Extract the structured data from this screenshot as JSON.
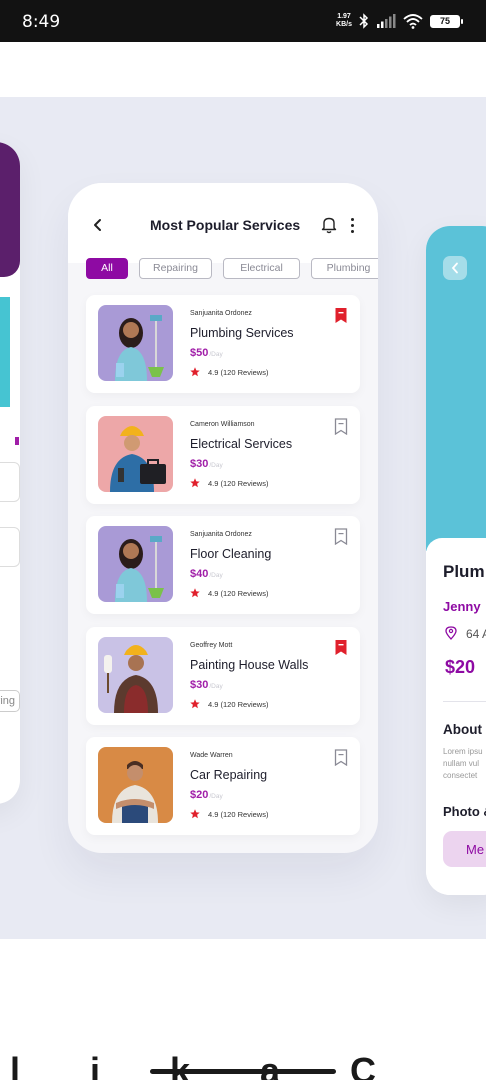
{
  "status_bar": {
    "time": "8:49",
    "speed_value": "1.97",
    "speed_unit": "KB/s",
    "battery": "75"
  },
  "main": {
    "title": "Most Popular Services",
    "filters": [
      "All",
      "Repairing",
      "Electrical",
      "Plumbing"
    ],
    "active_filter": "All",
    "services": [
      {
        "provider": "Sanjuanita Ordonez",
        "name": "Plumbing Services",
        "price": "$50",
        "unit": "/Day",
        "rating": "4.9 (120 Reviews)",
        "bookmarked": true,
        "thumb_bg": "#a99ad6"
      },
      {
        "provider": "Cameron Williamson",
        "name": "Electrical Services",
        "price": "$30",
        "unit": "/Day",
        "rating": "4.9 (120 Reviews)",
        "bookmarked": false,
        "thumb_bg": "#eda7a8"
      },
      {
        "provider": "Sanjuanita Ordonez",
        "name": "Floor Cleaning",
        "price": "$40",
        "unit": "/Day",
        "rating": "4.9 (120 Reviews)",
        "bookmarked": false,
        "thumb_bg": "#a99ad6"
      },
      {
        "provider": "Geoffrey Mott",
        "name": "Painting House Walls",
        "price": "$30",
        "unit": "/Day",
        "rating": "4.9 (120 Reviews)",
        "bookmarked": true,
        "thumb_bg": "#c9c2e6"
      },
      {
        "provider": "Wade Warren",
        "name": "Car Repairing",
        "price": "$20",
        "unit": "/Day",
        "rating": "4.9 (120 Reviews)",
        "bookmarked": false,
        "thumb_bg": "#d88a45"
      }
    ]
  },
  "right_card": {
    "title": "Plum",
    "owner": "Jenny",
    "address": "64 A",
    "price": "$20",
    "about": "About",
    "description": "Lorem ipsu\nnullam vul\nconsectet",
    "photo_label": "Photo &",
    "message_button": "Me"
  },
  "left_card": {
    "tag": "ring"
  },
  "bottom_text": "l i k a   C",
  "colors": {
    "accent": "#8e0aa3",
    "price": "#a01ea8",
    "bookmark_active": "#e0202c",
    "star": "#e0202c",
    "stage_bg": "#e8eaf3",
    "right_hero": "#5bc2d8"
  }
}
